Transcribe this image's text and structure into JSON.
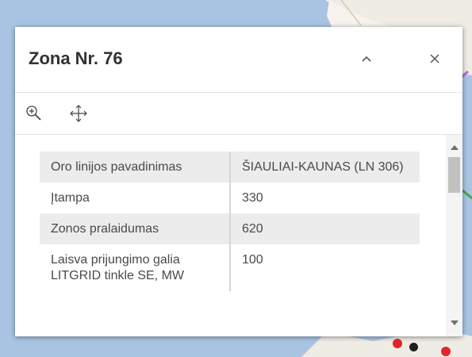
{
  "popup": {
    "title": "Zona Nr. 76",
    "collapse_icon": "chevron-up-icon",
    "close_icon": "close-icon",
    "actions": [
      {
        "icon": "zoom-to-icon"
      },
      {
        "icon": "pan-move-icon"
      }
    ]
  },
  "attributes": [
    {
      "key": "Oro linijos pavadinimas",
      "value": "ŠIAULIAI-KAUNAS (LN 306)"
    },
    {
      "key": "Įtampa",
      "value": "330"
    },
    {
      "key": "Zonos pralaidumas",
      "value": "620"
    },
    {
      "key": "Laisva prijungimo galia LITGRID tinkle SE, MW",
      "value": "100"
    }
  ],
  "colors": {
    "map_water": "#a9c4e3",
    "map_land": "#efece6",
    "row_alt": "#ececec",
    "text": "#323232"
  }
}
